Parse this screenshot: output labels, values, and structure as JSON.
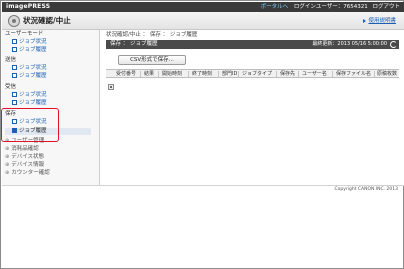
{
  "app": {
    "brand": "imagePRESS"
  },
  "topbar": {
    "portal_link": "ポータルへ",
    "login_user": "ログインユーザー：7654321",
    "logout_link": "ログアウト"
  },
  "header": {
    "title": "状況確認/中止",
    "manual_link": "使用説明書"
  },
  "sidebar": {
    "sections": [
      {
        "label": "ユーザーモード",
        "items": [
          "ジョブ状況",
          "ジョブ履歴"
        ]
      },
      {
        "label": "送信",
        "items": [
          "ジョブ状況",
          "ジョブ履歴"
        ]
      },
      {
        "label": "受信",
        "items": [
          "ジョブ状況",
          "ジョブ履歴"
        ]
      },
      {
        "label": "保存",
        "items": [
          "ジョブ状況",
          "ジョブ履歴"
        ]
      }
    ],
    "others": [
      "ユーザー管理",
      "消耗品確認",
      "デバイス状態",
      "デバイス情報",
      "カウンター確認"
    ]
  },
  "main": {
    "breadcrumb": "状況確認/中止 ： 保存 ： ジョブ履歴",
    "panel_title": "保存 ： ジョブ履歴",
    "updated": "最終更新：2013 05/16 5:00:00",
    "csv_button": "CSV形式で保存...",
    "columns": [
      "受付番号",
      "結果",
      "開始時刻",
      "終了時刻",
      "部門ID",
      "ジョブタイプ",
      "保存先",
      "ユーザー名",
      "保存ファイル名",
      "原稿枚数"
    ]
  },
  "footer": {
    "copyright": "Copyright CANON INC. 2013"
  },
  "colors": {
    "highlight": "#e3122a",
    "link": "#1a5fb4",
    "topbar": "#3a3a3a"
  }
}
